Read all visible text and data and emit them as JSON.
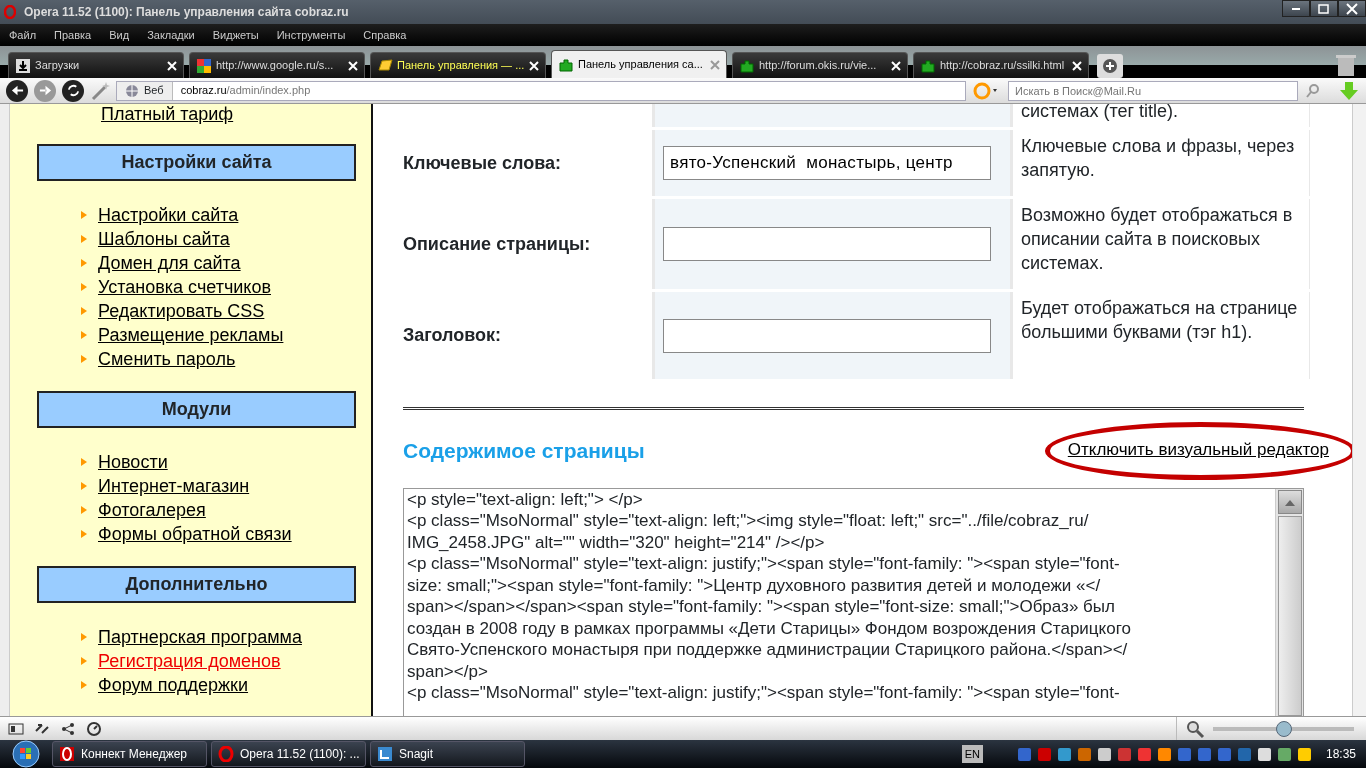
{
  "window": {
    "title": "Opera 11.52 (1100): Панель управления сайта cobraz.ru"
  },
  "menu": [
    "Файл",
    "Правка",
    "Вид",
    "Закладки",
    "Виджеты",
    "Инструменты",
    "Справка"
  ],
  "tabs": [
    {
      "label": "Загрузки",
      "kind": "download",
      "selected": false,
      "highlighted": false
    },
    {
      "label": "http://www.google.ru/s...",
      "kind": "google",
      "selected": false,
      "highlighted": false
    },
    {
      "label": "Панель управления — ...",
      "kind": "note",
      "selected": false,
      "highlighted": true
    },
    {
      "label": "Панель управления са...",
      "kind": "puzzle",
      "selected": true,
      "highlighted": false
    },
    {
      "label": "http://forum.okis.ru/vie...",
      "kind": "puzzle",
      "selected": false,
      "highlighted": false
    },
    {
      "label": "http://cobraz.ru/ssilki.html",
      "kind": "puzzle",
      "selected": false,
      "highlighted": false
    }
  ],
  "address_bar": {
    "mode": "Веб",
    "url_host": "cobraz.ru",
    "url_path": "/admin/index.php"
  },
  "search": {
    "placeholder": "Искать в Поиск@Mail.Ru"
  },
  "sidebar": {
    "top_link": "Платный тариф",
    "sections": [
      {
        "title": "Настройки сайта",
        "links": [
          {
            "label": "Настройки сайта",
            "highlighted": false
          },
          {
            "label": "Шаблоны сайта",
            "highlighted": false
          },
          {
            "label": "Домен для сайта",
            "highlighted": false
          },
          {
            "label": "Установка счетчиков",
            "highlighted": false
          },
          {
            "label": "Редактировать CSS",
            "highlighted": false
          },
          {
            "label": "Размещение рекламы",
            "highlighted": false
          },
          {
            "label": "Сменить пароль",
            "highlighted": false
          }
        ]
      },
      {
        "title": "Модули",
        "links": [
          {
            "label": "Новости",
            "highlighted": false
          },
          {
            "label": "Интернет-магазин",
            "highlighted": false
          },
          {
            "label": "Фотогалерея",
            "highlighted": false
          },
          {
            "label": "Формы обратной связи",
            "highlighted": false
          }
        ]
      },
      {
        "title": "Дополнительно",
        "links": [
          {
            "label": "Партнерская программа",
            "highlighted": false
          },
          {
            "label": "Регистрация доменов",
            "highlighted": true
          },
          {
            "label": "Форум поддержки",
            "highlighted": false
          }
        ]
      }
    ]
  },
  "form_rows": [
    {
      "hint": "системах (тег title)."
    },
    {
      "label": "Ключевые слова:",
      "value": "вято-Успенский  монастырь, центр",
      "hint": "Ключевые слова и фразы, через запятую."
    },
    {
      "label": "Описание страницы:",
      "hint": "Возможно будет отображаться в описании сайта в поисковых системах."
    },
    {
      "label": "Заголовок:",
      "hint": "Будет отображаться на странице большими буквами (тэг h1)."
    }
  ],
  "content": {
    "heading": "Содержимое страницы",
    "toggle_link": "Отключить визуальный редактор",
    "source_lines": [
      "<p style=\"text-align: left;\"> </p>",
      "<p class=\"MsoNormal\" style=\"text-align: left;\"><img style=\"float: left;\" src=\"../file/cobraz_ru/",
      "IMG_2458.JPG\" alt=\"\" width=\"320\" height=\"214\" /></p>",
      "<p class=\"MsoNormal\" style=\"text-align: justify;\"><span style=\"font-family: \"><span style=\"font-",
      "size: small;\"><span style=\"font-family: \">Центр духовного развития детей и молодежи «</",
      "span></span></span><span style=\"font-family: \"><span style=\"font-size: small;\">Образ» был",
      "создан в 2008 году в рамках программы «Дети Старицы» Фондом возрождения Старицкого",
      "Свято-Успенского монастыря при поддержке администрации Старицкого района.</span></",
      "span></p>",
      "<p class=\"MsoNormal\" style=\"text-align: justify;\"><span style=\"font-family: \"><span style=\"font-"
    ]
  },
  "zoom": {
    "level": 0.5
  },
  "taskbar": {
    "buttons": [
      {
        "label": "Коннект Менеджер",
        "kind": "connect"
      },
      {
        "label": "Opera 11.52 (1100): ...",
        "kind": "opera"
      },
      {
        "label": "Snagit",
        "kind": "snagit"
      }
    ],
    "language": "EN",
    "clock": "18:35"
  }
}
